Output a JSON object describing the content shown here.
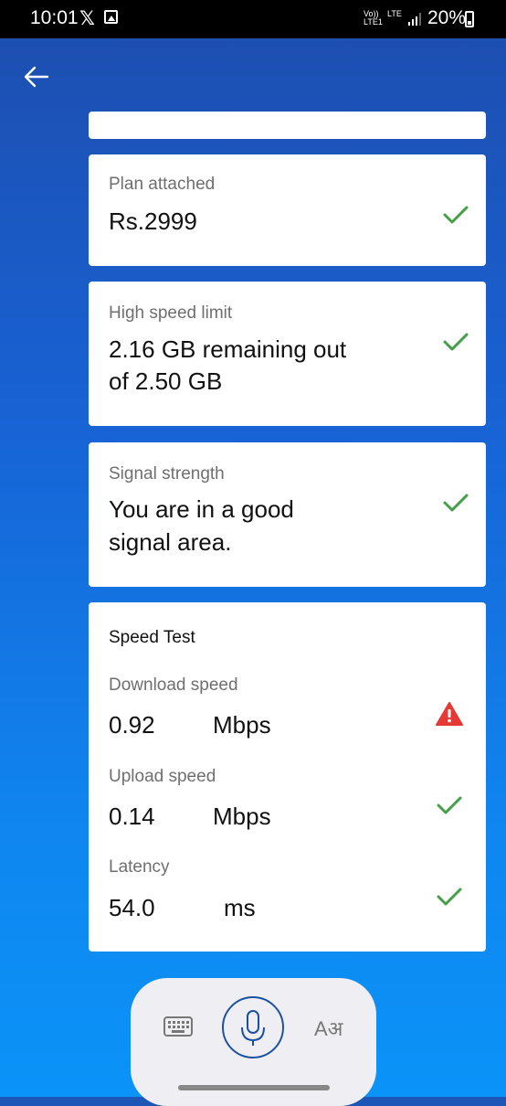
{
  "status_bar": {
    "time": "10:01",
    "x_logo": "𝕏",
    "volte": "Vo)) LTE1",
    "lte": "LTE",
    "battery": "20%"
  },
  "header": {
    "back_icon": "arrow-left-icon"
  },
  "plan": {
    "label": "Plan attached",
    "value": "Rs.2999",
    "status": "ok"
  },
  "high_speed": {
    "label": "High speed limit",
    "value_line1": "2.16 GB remaining out",
    "value_line2": "of 2.50 GB",
    "status": "ok"
  },
  "signal": {
    "label": "Signal strength",
    "value_line1": "You are in a good",
    "value_line2": "signal area.",
    "status": "ok"
  },
  "speed_test": {
    "title": "Speed Test",
    "download": {
      "label": "Download speed",
      "value": "0.92",
      "unit": "Mbps",
      "status": "warning"
    },
    "upload": {
      "label": "Upload speed",
      "value": "0.14",
      "unit": "Mbps",
      "status": "ok"
    },
    "latency": {
      "label": "Latency",
      "value": "54.0",
      "unit": "ms",
      "status": "ok"
    }
  },
  "keyboard_bar": {
    "lang_label": "Aअ"
  },
  "colors": {
    "check_green": "#43a047",
    "warning_red": "#e53935",
    "accent_blue": "#1b4fa0"
  }
}
